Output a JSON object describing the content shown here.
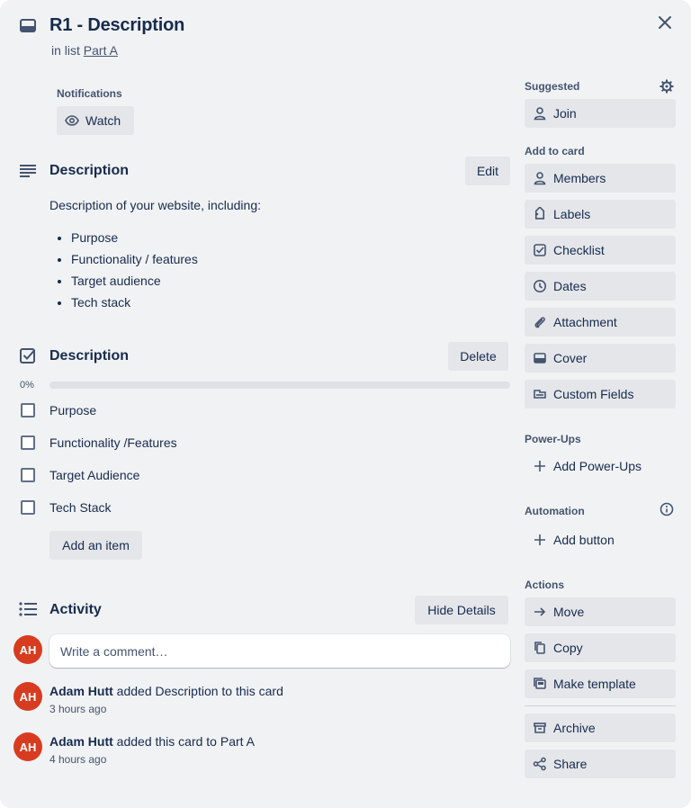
{
  "card": {
    "title": "R1 - Description",
    "in_list_prefix": "in list",
    "list_name": "Part A"
  },
  "notifications": {
    "label": "Notifications",
    "watch_label": "Watch"
  },
  "description": {
    "title": "Description",
    "edit_label": "Edit",
    "intro": "Description of your website, including:",
    "bullets": [
      "Purpose",
      "Functionality / features",
      "Target audience",
      "Tech stack"
    ]
  },
  "checklist": {
    "title": "Description",
    "delete_label": "Delete",
    "progress_text": "0%",
    "progress": 0,
    "items": [
      {
        "label": "Purpose",
        "checked": false
      },
      {
        "label": "Functionality /Features",
        "checked": false
      },
      {
        "label": "Target Audience",
        "checked": false
      },
      {
        "label": "Tech Stack",
        "checked": false
      }
    ],
    "add_item_label": "Add an item"
  },
  "activity": {
    "title": "Activity",
    "hide_details_label": "Hide Details",
    "comment_placeholder": "Write a comment…",
    "avatar_initials": "AH",
    "entries": [
      {
        "user": "Adam Hutt",
        "text": "added Description to this card",
        "time": "3 hours ago"
      },
      {
        "user": "Adam Hutt",
        "text": "added this card to Part A",
        "time": "4 hours ago"
      }
    ]
  },
  "sidebar": {
    "suggested_label": "Suggested",
    "join_label": "Join",
    "add_to_card_label": "Add to card",
    "add_to_card": [
      {
        "label": "Members",
        "icon": "person-icon"
      },
      {
        "label": "Labels",
        "icon": "tag-icon"
      },
      {
        "label": "Checklist",
        "icon": "checkbox-icon"
      },
      {
        "label": "Dates",
        "icon": "clock-icon"
      },
      {
        "label": "Attachment",
        "icon": "paperclip-icon"
      },
      {
        "label": "Cover",
        "icon": "cover-icon"
      },
      {
        "label": "Custom Fields",
        "icon": "custom-fields-icon"
      }
    ],
    "powerups_label": "Power-Ups",
    "add_powerups_label": "Add Power-Ups",
    "automation_label": "Automation",
    "add_button_label": "Add button",
    "actions_label": "Actions",
    "actions": [
      {
        "label": "Move",
        "icon": "arrow-right-icon"
      },
      {
        "label": "Copy",
        "icon": "copy-icon"
      },
      {
        "label": "Make template",
        "icon": "template-icon"
      }
    ],
    "archive_label": "Archive",
    "share_label": "Share"
  },
  "colors": {
    "avatar": "#d83c20",
    "button_bg": "#e4e6ea",
    "modal_bg": "#f1f2f4",
    "text": "#172b4d"
  }
}
